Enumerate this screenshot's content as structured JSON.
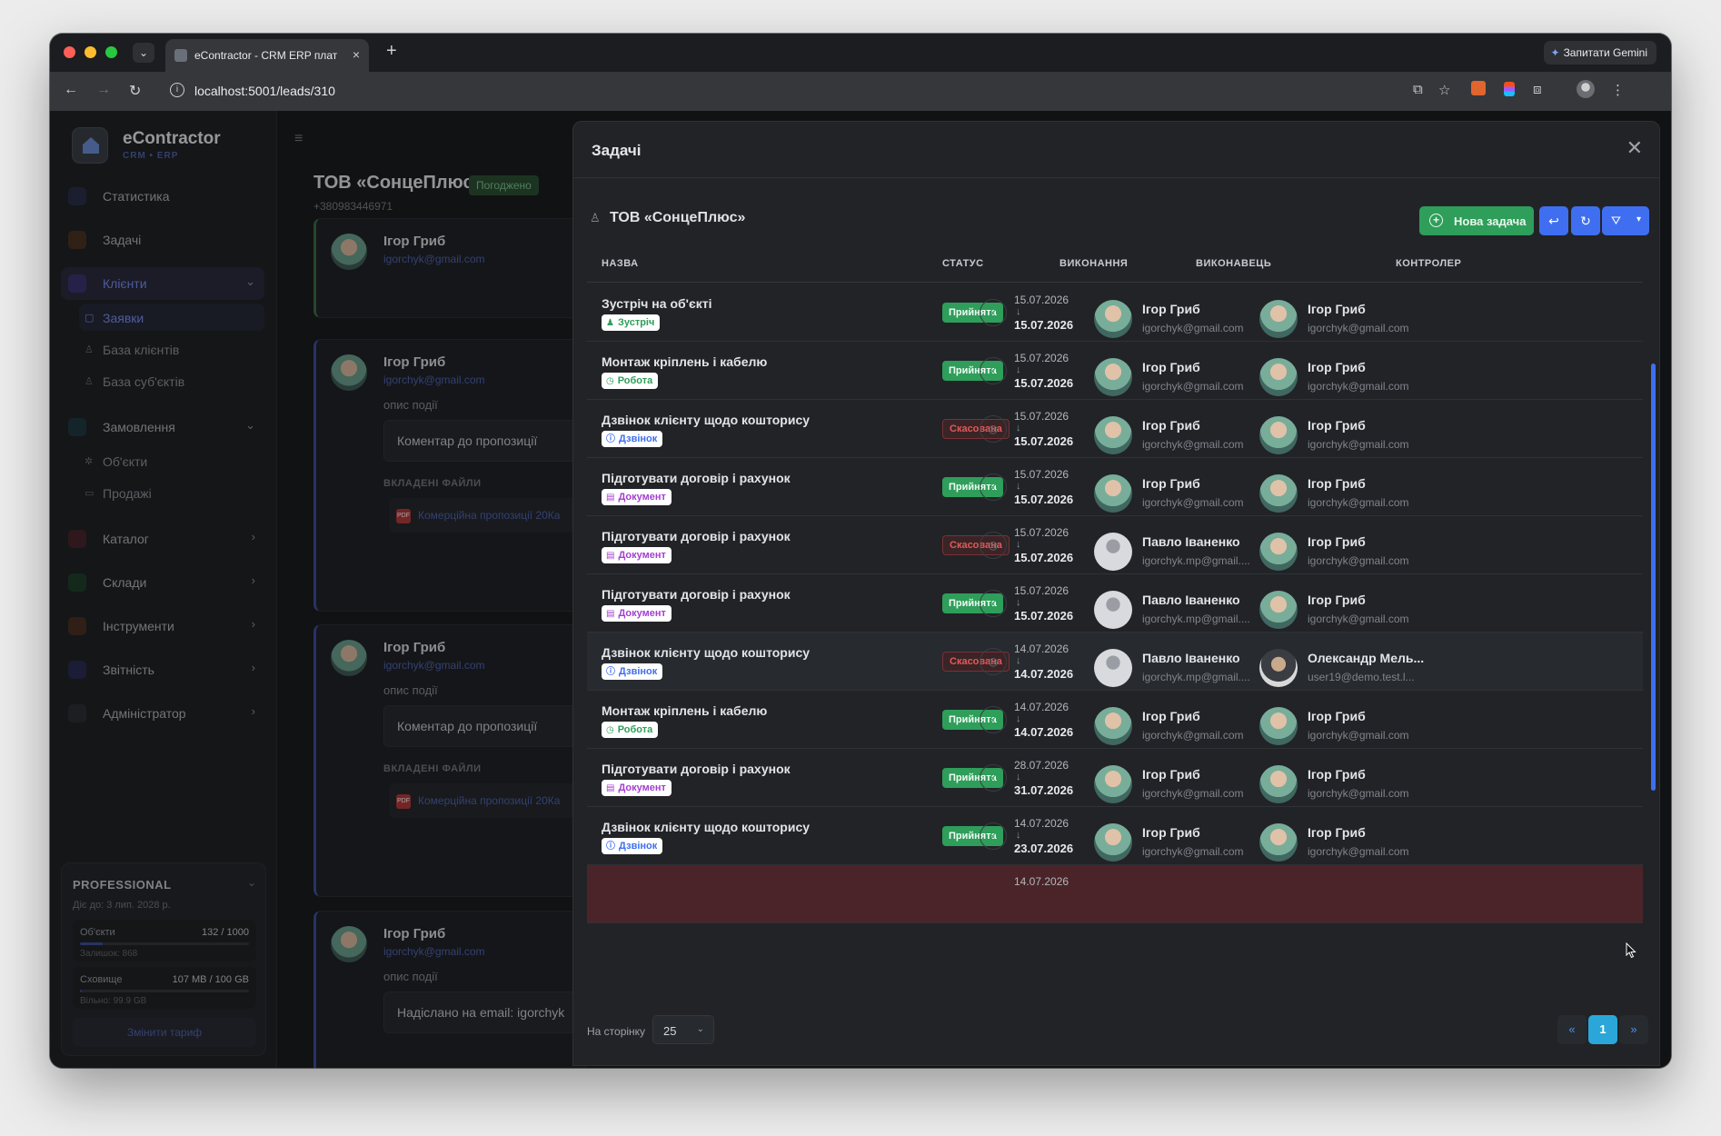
{
  "browser": {
    "tab_title": "eContractor - CRM ERP плат",
    "tab_close": "×",
    "new_tab": "+",
    "gemini_label": "Запитати Gemini",
    "url": "localhost:5001/leads/310"
  },
  "sidebar": {
    "brand": "eContractor",
    "brand_sub": "CRM • ERP",
    "items": [
      {
        "label": "Статистика",
        "color": "#4f63b0"
      },
      {
        "label": "Задачі",
        "color": "#d07a3a"
      },
      {
        "label": "Клієнти",
        "color": "#6b5fd6"
      },
      {
        "label": "Замовлення",
        "color": "#2f7f8e"
      },
      {
        "label": "Каталог",
        "color": "#c94a55"
      },
      {
        "label": "Склади",
        "color": "#3a9e5a"
      },
      {
        "label": "Інструменти",
        "color": "#c9733a"
      },
      {
        "label": "Звітність",
        "color": "#5a5fc9"
      },
      {
        "label": "Адміністратор",
        "color": "#5f6369"
      }
    ],
    "clients_sub": [
      "Заявки",
      "База клієнтів",
      "База суб'єктів"
    ],
    "orders_sub": [
      "Об'єкти",
      "Продажі"
    ],
    "plan": {
      "title": "PROFESSIONAL",
      "expires": "Діє до: 3 лип. 2028 р.",
      "objects_label": "Об'єкти",
      "objects_value": "132 / 1000",
      "objects_fill": 0.132,
      "objects_note": "Залишок: 868",
      "storage_label": "Сховище",
      "storage_value": "107 MB / 100 GB",
      "storage_fill": 0.001,
      "storage_note": "Вільно: 99.9 GB",
      "change_button": "Змінити тариф"
    }
  },
  "lead": {
    "title": "ТОВ «СонцеПлюс»",
    "status": "Погоджено",
    "phone": "+380983446971",
    "events": [
      {
        "name": "Ігор Гриб",
        "email": "igorchyk@gmail.com"
      },
      {
        "name": "Ігор Гриб",
        "email": "igorchyk@gmail.com",
        "label": "опис події",
        "comment": "Коментар до пропозиції",
        "files_label": "ВКЛАДЕНІ ФАЙЛИ",
        "file": "Комерційна пропозиції 20Ка"
      },
      {
        "name": "Ігор Гриб",
        "email": "igorchyk@gmail.com",
        "label": "опис події",
        "comment": "Коментар до пропозиції",
        "files_label": "ВКЛАДЕНІ ФАЙЛИ",
        "file": "Комерційна пропозиції 20Ка"
      },
      {
        "name": "Ігор Гриб",
        "email": "igorchyk@gmail.com",
        "label": "опис події",
        "comment": "Надіслано на email: igorchyk"
      }
    ]
  },
  "modal": {
    "title": "Задачі",
    "context": "ТОВ «СонцеПлюс»",
    "new_task": "Нова задача",
    "columns": [
      "НАЗВА",
      "СТАТУС",
      "ВИКОНАННЯ",
      "ВИКОНАВЕЦЬ",
      "КОНТРОЛЕР"
    ],
    "rows": [
      {
        "name": "Зустріч на об'єкті",
        "type": "Зустріч",
        "type_color": "green",
        "type_icon": "♟",
        "status": "Прийнята",
        "status_kind": "accepted",
        "from": "15.07.2026",
        "to": "15.07.2026",
        "executor": {
          "name": "Ігор Гриб",
          "email": "igorchyk@gmail.com",
          "avatar": "igor"
        },
        "controller": {
          "name": "Ігор Гриб",
          "email": "igorchyk@gmail.com",
          "avatar": "igor"
        }
      },
      {
        "name": "Монтаж кріплень і кабелю",
        "type": "Робота",
        "type_color": "green",
        "type_icon": "◷",
        "status": "Прийнята",
        "status_kind": "accepted",
        "from": "15.07.2026",
        "to": "15.07.2026",
        "executor": {
          "name": "Ігор Гриб",
          "email": "igorchyk@gmail.com",
          "avatar": "igor"
        },
        "controller": {
          "name": "Ігор Гриб",
          "email": "igorchyk@gmail.com",
          "avatar": "igor"
        }
      },
      {
        "name": "Дзвінок клієнту щодо кошторису",
        "type": "Дзвінок",
        "type_color": "blue",
        "type_icon": "ⓘ",
        "status": "Скасована",
        "status_kind": "cancelled",
        "from": "15.07.2026",
        "to": "15.07.2026",
        "executor": {
          "name": "Ігор Гриб",
          "email": "igorchyk@gmail.com",
          "avatar": "igor"
        },
        "controller": {
          "name": "Ігор Гриб",
          "email": "igorchyk@gmail.com",
          "avatar": "igor"
        }
      },
      {
        "name": "Підготувати договір і рахунок",
        "type": "Документ",
        "type_color": "purple",
        "type_icon": "▤",
        "status": "Прийнята",
        "status_kind": "accepted",
        "from": "15.07.2026",
        "to": "15.07.2026",
        "executor": {
          "name": "Ігор Гриб",
          "email": "igorchyk@gmail.com",
          "avatar": "igor"
        },
        "controller": {
          "name": "Ігор Гриб",
          "email": "igorchyk@gmail.com",
          "avatar": "igor"
        }
      },
      {
        "name": "Підготувати договір і рахунок",
        "type": "Документ",
        "type_color": "purple",
        "type_icon": "▤",
        "status": "Скасована",
        "status_kind": "cancelled",
        "from": "15.07.2026",
        "to": "15.07.2026",
        "executor": {
          "name": "Павло Іваненко",
          "email": "igorchyk.mp@gmail....",
          "avatar": "pavlo"
        },
        "controller": {
          "name": "Ігор Гриб",
          "email": "igorchyk@gmail.com",
          "avatar": "igor"
        }
      },
      {
        "name": "Підготувати договір і рахунок",
        "type": "Документ",
        "type_color": "purple",
        "type_icon": "▤",
        "status": "Прийнята",
        "status_kind": "accepted",
        "from": "15.07.2026",
        "to": "15.07.2026",
        "executor": {
          "name": "Павло Іваненко",
          "email": "igorchyk.mp@gmail....",
          "avatar": "pavlo"
        },
        "controller": {
          "name": "Ігор Гриб",
          "email": "igorchyk@gmail.com",
          "avatar": "igor"
        }
      },
      {
        "name": "Дзвінок клієнту щодо кошторису",
        "type": "Дзвінок",
        "type_color": "blue",
        "type_icon": "ⓘ",
        "status": "Скасована",
        "status_kind": "cancelled",
        "from": "14.07.2026",
        "to": "14.07.2026",
        "executor": {
          "name": "Павло Іваненко",
          "email": "igorchyk.mp@gmail....",
          "avatar": "pavlo"
        },
        "controller": {
          "name": "Олександр Мель...",
          "email": "user19@demo.test.l...",
          "avatar": "olex"
        }
      },
      {
        "name": "Монтаж кріплень і кабелю",
        "type": "Робота",
        "type_color": "green",
        "type_icon": "◷",
        "status": "Прийнята",
        "status_kind": "accepted",
        "from": "14.07.2026",
        "to": "14.07.2026",
        "executor": {
          "name": "Ігор Гриб",
          "email": "igorchyk@gmail.com",
          "avatar": "igor"
        },
        "controller": {
          "name": "Ігор Гриб",
          "email": "igorchyk@gmail.com",
          "avatar": "igor"
        }
      },
      {
        "name": "Підготувати договір і рахунок",
        "type": "Документ",
        "type_color": "purple",
        "type_icon": "▤",
        "status": "Прийнята",
        "status_kind": "accepted",
        "from": "28.07.2026",
        "to": "31.07.2026",
        "executor": {
          "name": "Ігор Гриб",
          "email": "igorchyk@gmail.com",
          "avatar": "igor"
        },
        "controller": {
          "name": "Ігор Гриб",
          "email": "igorchyk@gmail.com",
          "avatar": "igor"
        }
      },
      {
        "name": "Дзвінок клієнту щодо кошторису",
        "type": "Дзвінок",
        "type_color": "blue",
        "type_icon": "ⓘ",
        "status": "Прийнята",
        "status_kind": "accepted",
        "from": "14.07.2026",
        "to": "23.07.2026",
        "executor": {
          "name": "Ігор Гриб",
          "email": "igorchyk@gmail.com",
          "avatar": "igor"
        },
        "controller": {
          "name": "Ігор Гриб",
          "email": "igorchyk@gmail.com",
          "avatar": "igor"
        }
      }
    ],
    "partial_row_date": "14.07.2026",
    "pager": {
      "label": "На сторінку",
      "per_page": "25",
      "prev": "«",
      "current": "1",
      "next": "»"
    }
  }
}
